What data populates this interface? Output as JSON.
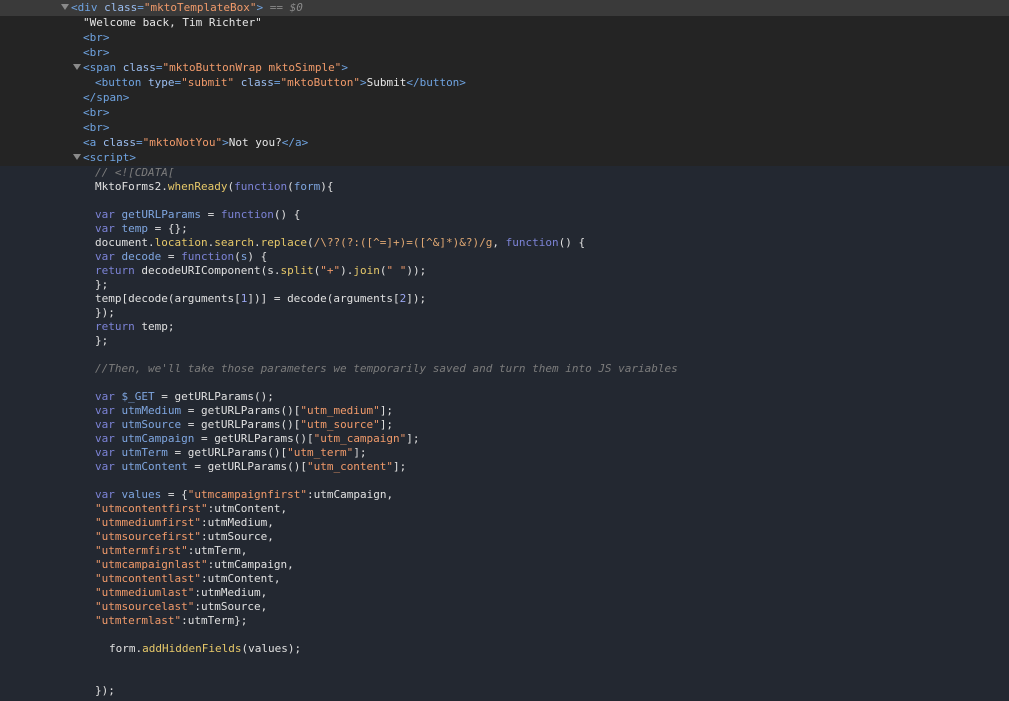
{
  "dom": {
    "div_line": {
      "tag_open": "<div",
      "attr": "class",
      "value": "\"mktoTemplateBox\"",
      "tag_close": ">",
      "selected_marker": "== $0"
    },
    "welcome_text": "\"Welcome back, Tim Richter\"",
    "br": "<br>",
    "span_line": {
      "tag_open": "<span",
      "attr": "class",
      "value": "\"mktoButtonWrap mktoSimple\"",
      "tag_close": ">"
    },
    "button_line": {
      "tag_open": "<button",
      "attr1": "type",
      "value1": "\"submit\"",
      "attr2": "class",
      "value2": "\"mktoButton\"",
      "gt": ">",
      "text": "Submit",
      "tag_end": "</button>"
    },
    "span_close": "</span>",
    "anchor_line": {
      "tag_open": "<a",
      "attr": "class",
      "value": "\"mktoNotYou\"",
      "gt": ">",
      "text": "Not you?",
      "tag_end": "</a>"
    },
    "script_open": "<script>"
  },
  "code": {
    "cdata": "// <![CDATA[",
    "l_ready": {
      "obj": "MktoForms2",
      "method": "whenReady",
      "kw": "function",
      "param": "form"
    },
    "l_geturl": {
      "kw": "var",
      "name": "getURLParams",
      "kw2": "function"
    },
    "l_temp": {
      "kw": "var",
      "name": "temp",
      "rest": " = {};"
    },
    "l_replace": {
      "doc": "document",
      "loc": "location",
      "search": "search",
      "replace": "replace",
      "regex": "/\\??(?:([^=]+)=([^&]*)&?)/g",
      "kw": "function"
    },
    "l_decode": {
      "kw": "var",
      "name": "decode",
      "kw2": "function",
      "param": "s"
    },
    "l_return1": {
      "kw": "return",
      "call": "decodeURIComponent(s.",
      "split": "split",
      "s1": "\"+\"",
      "join": "join",
      "s2": "\" \""
    },
    "l_close1": "};",
    "l_tempassign": {
      "a": "temp[decode(arguments[",
      "n1": "1",
      "b": "])] = decode(arguments[",
      "n2": "2",
      "c": "]);"
    },
    "l_close2": "});",
    "l_return2": {
      "kw": "return",
      "rest": " temp;"
    },
    "l_close3": "};",
    "comment": "//Then, we'll take those parameters we temporarily saved and turn them into JS variables",
    "l_get": {
      "kw": "var",
      "name": "$_GET",
      "rest": " = getURLParams();"
    },
    "utm_vars": [
      {
        "kw": "var",
        "name": "utmMedium",
        "mid": " = getURLParams()[",
        "key": "\"utm_medium\"",
        "end": "];"
      },
      {
        "kw": "var",
        "name": "utmSource",
        "mid": " = getURLParams()[",
        "key": "\"utm_source\"",
        "end": "];"
      },
      {
        "kw": "var",
        "name": "utmCampaign",
        "mid": " = getURLParams()[",
        "key": "\"utm_campaign\"",
        "end": "];"
      },
      {
        "kw": "var",
        "name": "utmTerm",
        "mid": " = getURLParams()[",
        "key": "\"utm_term\"",
        "end": "];"
      },
      {
        "kw": "var",
        "name": "utmContent",
        "mid": " = getURLParams()[",
        "key": "\"utm_content\"",
        "end": "];"
      }
    ],
    "l_values": {
      "kw": "var",
      "name": "values",
      "mid": " = {",
      "key": "\"utmcampaignfirst\"",
      "end": ":utmCampaign,"
    },
    "value_pairs": [
      {
        "key": "\"utmcontentfirst\"",
        "val": ":utmContent,"
      },
      {
        "key": "\"utmmediumfirst\"",
        "val": ":utmMedium,"
      },
      {
        "key": "\"utmsourcefirst\"",
        "val": ":utmSource,"
      },
      {
        "key": "\"utmtermfirst\"",
        "val": ":utmTerm,"
      },
      {
        "key": "\"utmcampaignlast\"",
        "val": ":utmCampaign,"
      },
      {
        "key": "\"utmcontentlast\"",
        "val": ":utmContent,"
      },
      {
        "key": "\"utmmediumlast\"",
        "val": ":utmMedium,"
      },
      {
        "key": "\"utmsourcelast\"",
        "val": ":utmSource,"
      },
      {
        "key": "\"utmtermlast\"",
        "val": ":utmTerm};"
      }
    ],
    "l_addhidden": {
      "obj": "form.",
      "method": "addHiddenFields",
      "rest": "(values);"
    },
    "l_end": "});"
  },
  "colors": {
    "background": "#242424",
    "selected_row": "#3a3a3a",
    "script_bg": "#232831",
    "tag": "#6fa3e0",
    "string": "#f09a6a",
    "keyword": "#7c83d6"
  }
}
